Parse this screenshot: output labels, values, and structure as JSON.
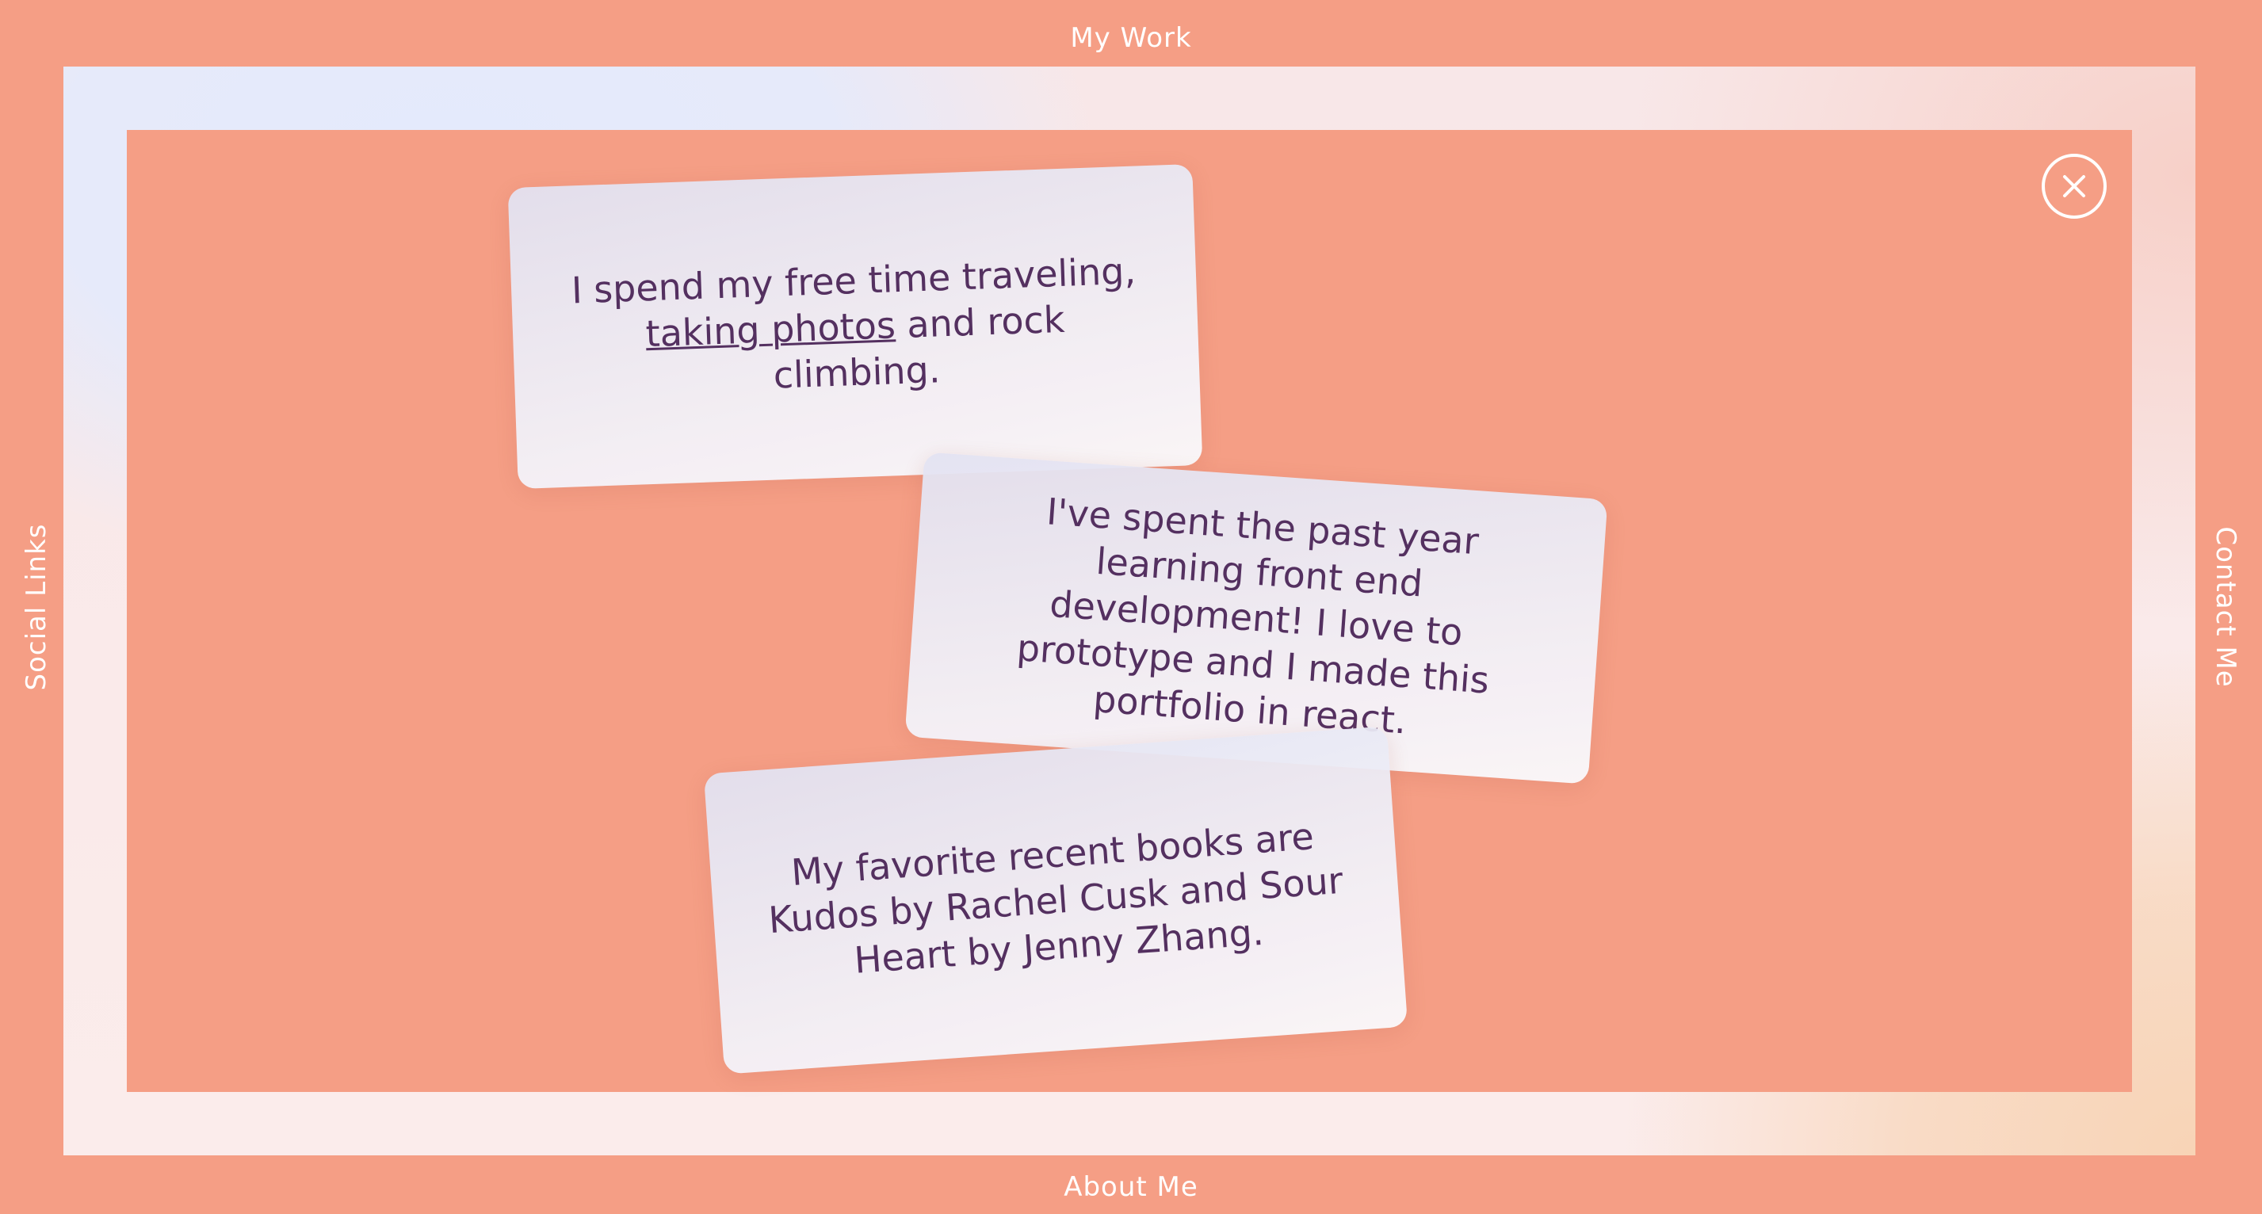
{
  "nav": {
    "top": "My Work",
    "bottom": "About Me",
    "left": "Social Links",
    "right": "Contact Me"
  },
  "close_icon": "close-x-icon",
  "cards": [
    {
      "before_link": "I spend my free time traveling,",
      "link": "taking photos",
      "after_link": "and rock climbing."
    },
    {
      "text": "I've spent the past year learning front end development! I love to prototype and I made this portfolio in react."
    },
    {
      "text": "My favorite recent books are Kudos by Rachel Cusk and Sour Heart by Jenny Zhang."
    }
  ],
  "colors": {
    "background": "#f59e85",
    "card_text": "#4a2a5e",
    "frame_blue": "#e4eafc",
    "frame_peach": "#f8d4b6"
  }
}
